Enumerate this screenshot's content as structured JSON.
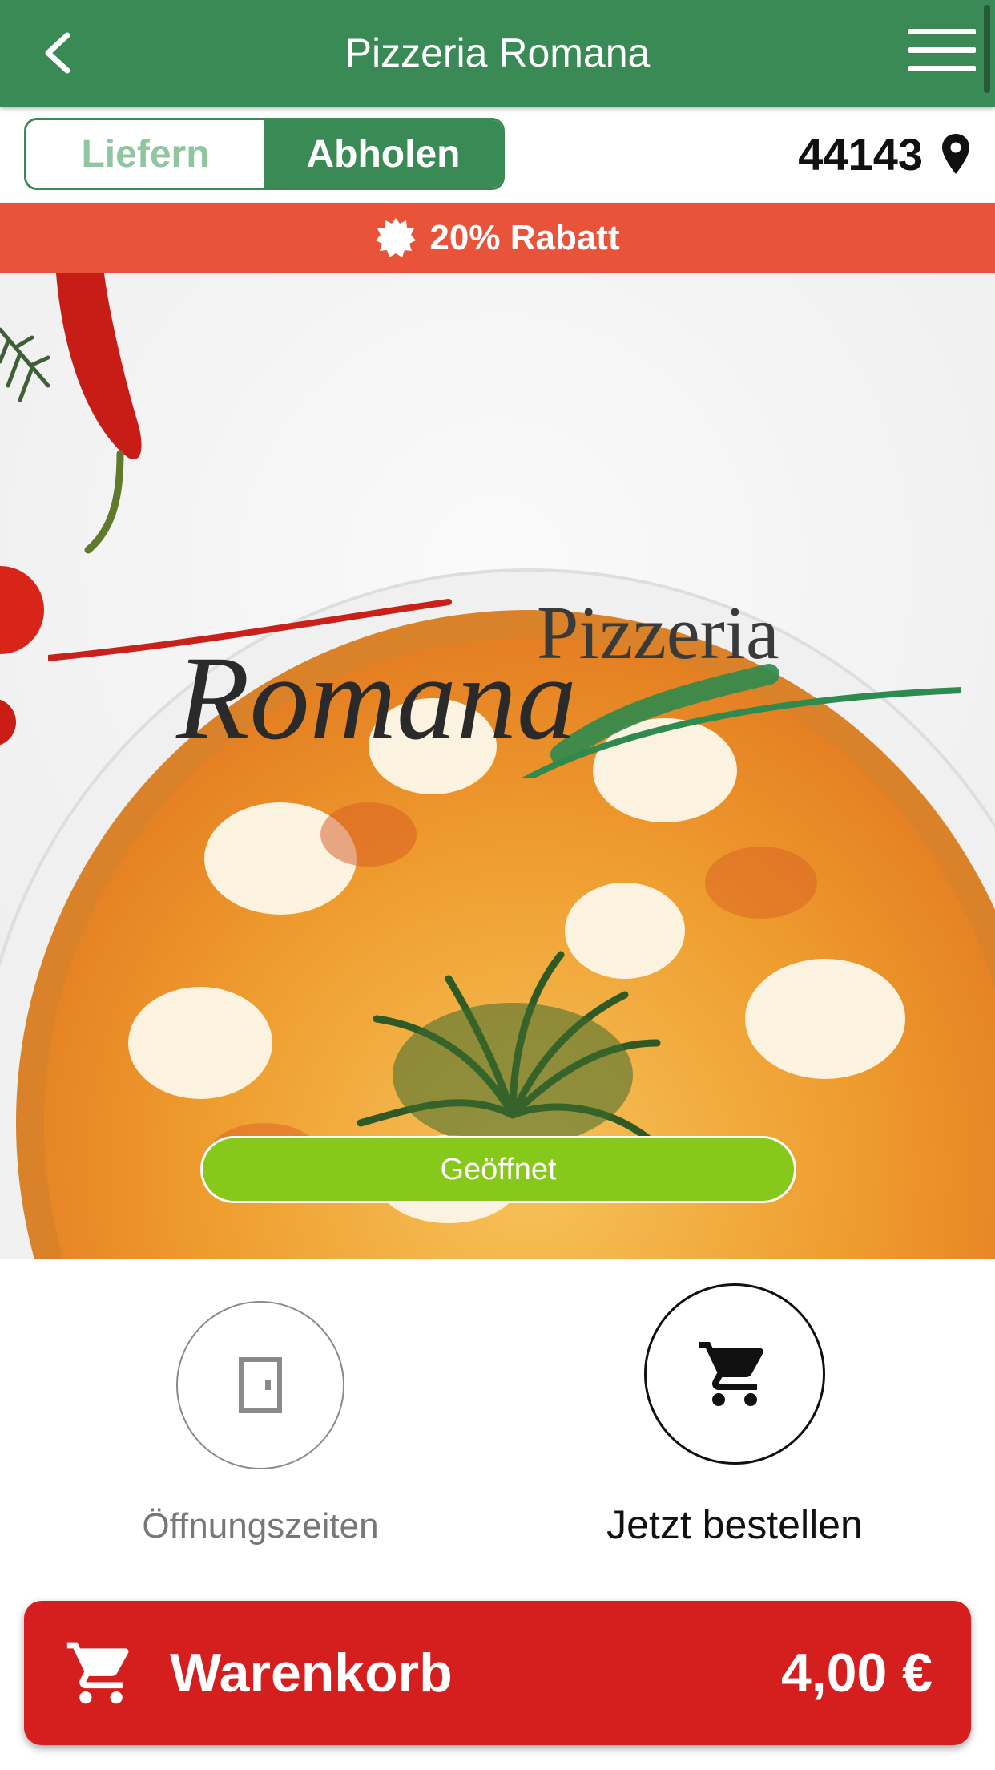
{
  "header": {
    "title": "Pizzeria Romana"
  },
  "mode_toggle": {
    "options": [
      "Liefern",
      "Abholen"
    ],
    "selected": "Abholen"
  },
  "location": {
    "zip": "44143",
    "icon": "map-pin-icon"
  },
  "promo": {
    "text": "20% Rabatt",
    "icon": "badge-icon"
  },
  "hero": {
    "status": "Geöffnet",
    "logo_line1": "Pizzeria",
    "logo_line2": "Romana"
  },
  "actions": {
    "hours_label": "Öffnungszeiten",
    "hours_icon": "door-icon",
    "order_label": "Jetzt bestellen",
    "order_icon": "cart-icon"
  },
  "cart": {
    "label": "Warenkorb",
    "total": "4,00 €"
  },
  "colors": {
    "header": "#3a8a55",
    "promo": "#e8533a",
    "status_open": "#86c91a",
    "cart": "#d51f1e"
  }
}
